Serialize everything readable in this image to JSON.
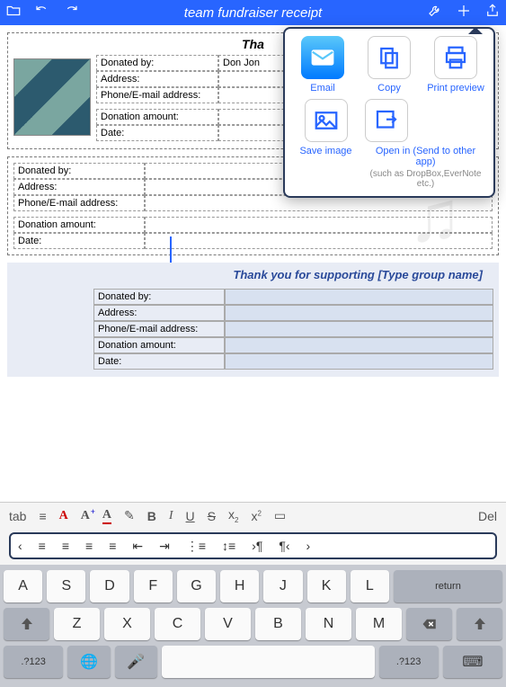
{
  "header": {
    "title": "team fundraiser receipt"
  },
  "popover": {
    "email": "Email",
    "copy": "Copy",
    "print": "Print preview",
    "save": "Save image",
    "open": "Open in (Send to other app)",
    "sub": "(such as DropBox,EverNote etc.)"
  },
  "receipt1": {
    "title": "Tha",
    "labels": {
      "donated": "Donated by:",
      "address": "Address:",
      "phone": "Phone/E-mail address:",
      "amount": "Donation amount:",
      "date": "Date:"
    },
    "values": {
      "donated": "Don Jon",
      "address": "",
      "phone": "",
      "amount": "",
      "date": ""
    }
  },
  "receipt2": {
    "labels": {
      "donated": "Donated by:",
      "address": "Address:",
      "phone": "Phone/E-mail address:",
      "amount": "Donation amount:",
      "date": "Date:"
    }
  },
  "receipt3": {
    "title": "Thank you for supporting [Type group name]",
    "labels": {
      "donated": "Donated by:",
      "address": "Address:",
      "phone": "Phone/E-mail address:",
      "amount": "Donation amount:",
      "date": "Date:"
    }
  },
  "fmt": {
    "tab": "tab",
    "del": "Del",
    "bold": "B",
    "italic": "I",
    "under": "U",
    "strike": "S",
    "sub": "x",
    "sup": "x"
  },
  "kb": {
    "r1": [
      "A",
      "S",
      "D",
      "F",
      "G",
      "H",
      "J",
      "K",
      "L"
    ],
    "r2": [
      "Z",
      "X",
      "C",
      "V",
      "B",
      "N",
      "M"
    ],
    "return": "return",
    "num": ".?123",
    "hide": "⌨"
  }
}
